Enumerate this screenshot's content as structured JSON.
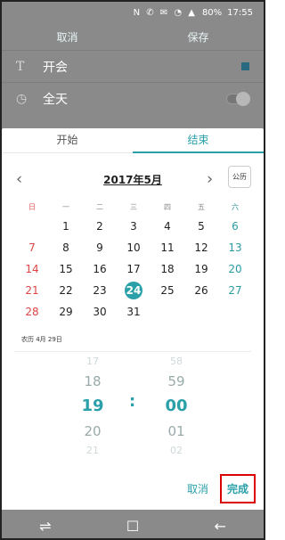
{
  "status": {
    "icons": "N ✆ ✉ ◔ ▲",
    "battery": "80%",
    "time": "17:55"
  },
  "editor": {
    "cancel_label": "取消",
    "save_label": "保存",
    "title_value": "开会",
    "allday_label": "全天"
  },
  "tabs": [
    {
      "label": "开始"
    },
    {
      "label": "结束"
    }
  ],
  "calendar": {
    "month_title": "2017年5月",
    "lunar_toggle": "公历",
    "weekdays": [
      "日",
      "一",
      "二",
      "三",
      "四",
      "五",
      "六"
    ],
    "weeks": [
      [
        "",
        "1",
        "2",
        "3",
        "4",
        "5",
        "6"
      ],
      [
        "7",
        "8",
        "9",
        "10",
        "11",
        "12",
        "13"
      ],
      [
        "14",
        "15",
        "16",
        "17",
        "18",
        "19",
        "20"
      ],
      [
        "21",
        "22",
        "23",
        "24",
        "25",
        "26",
        "27"
      ],
      [
        "28",
        "29",
        "30",
        "31",
        "",
        "",
        ""
      ]
    ],
    "selected_day": "24",
    "lunar_date": "农历 4月 29日"
  },
  "time": {
    "hours": [
      "17",
      "18",
      "19",
      "20",
      "21"
    ],
    "minutes": [
      "58",
      "59",
      "00",
      "01",
      "02"
    ],
    "separator": ":"
  },
  "actions": {
    "cancel_label": "取消",
    "done_label": "完成"
  },
  "navbar": {
    "recent_icon": "recent-apps-icon",
    "home_icon": "home-icon",
    "back_icon": "back-icon"
  }
}
